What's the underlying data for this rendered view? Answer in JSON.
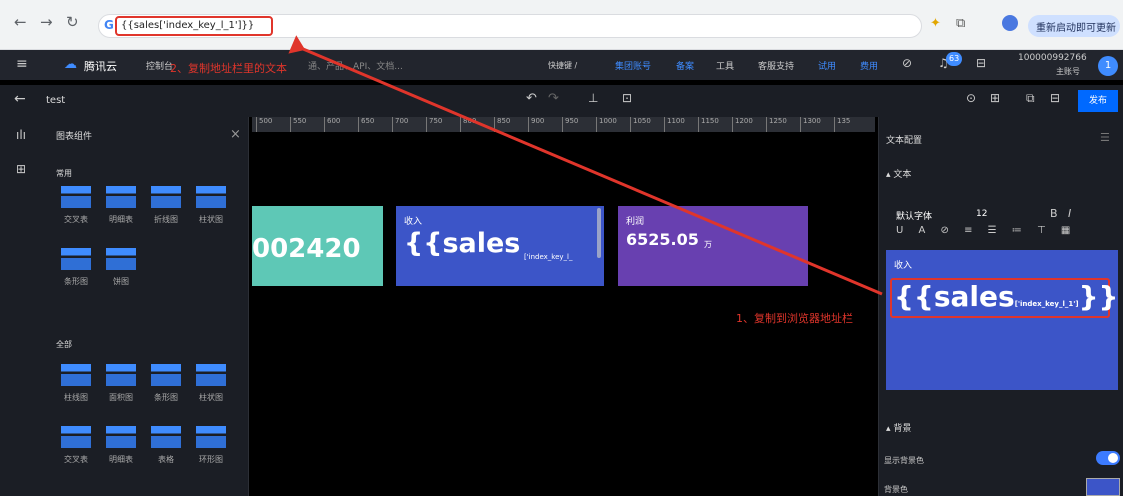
{
  "browser": {
    "url": "{{sales['index_key_l_1']}}",
    "update_label": "重新启动即可更新",
    "g_logo": "G"
  },
  "header": {
    "brand": "腾讯云",
    "console": "控制台",
    "search_hint": "通、产品、API、文档...",
    "shortcut": "快捷键 /",
    "group_account": "集团账号",
    "record": "备案",
    "tools": "工具",
    "support": "客服支持",
    "trial": "试用",
    "cost": "费用",
    "notif_count": "63",
    "account_id": "100000992766",
    "account_role": "主账号",
    "avatar": "1"
  },
  "toolbar": {
    "back": "←",
    "title": "test",
    "publish": "发布"
  },
  "left_panel": {
    "title": "图表组件",
    "common_title": "常用",
    "common": [
      "交叉表",
      "明细表",
      "折线图",
      "柱状图",
      "条形图",
      "饼图"
    ],
    "all_title": "全部",
    "all": [
      "柱线图",
      "面积图",
      "条形图",
      "柱状图",
      "交叉表",
      "明细表",
      "表格",
      "环形图"
    ]
  },
  "ruler": [
    "500",
    "550",
    "600",
    "650",
    "700",
    "750",
    "800",
    "850",
    "900",
    "950",
    "1000",
    "1050",
    "1100",
    "1150",
    "1200",
    "1250",
    "1300",
    "135"
  ],
  "cards": [
    {
      "value": "002420",
      "color": "#5ec8b6"
    },
    {
      "label": "收入",
      "value": "{{sales",
      "sub": "['index_key_l_",
      "color": "#3c55c8"
    },
    {
      "label": "利润",
      "value": "6525.05",
      "unit": "万",
      "color": "#6840b0"
    }
  ],
  "right_panel": {
    "title": "文本配置",
    "section_text": "文本",
    "font": "默认字体",
    "font_size": "12",
    "preview_label": "收入",
    "preview_main": "{{sales",
    "preview_sub": "['index_key_l_1']",
    "preview_end": "}}",
    "section_bg": "背景",
    "show_bg": "显示背景色",
    "bg_color_label": "背景色",
    "bg_color": "#3c55c8"
  },
  "annotations": {
    "step1": "1、复制到浏览器地址栏",
    "step2": "2、复制地址栏里的文本",
    "arrow_color": "#e0352b"
  }
}
